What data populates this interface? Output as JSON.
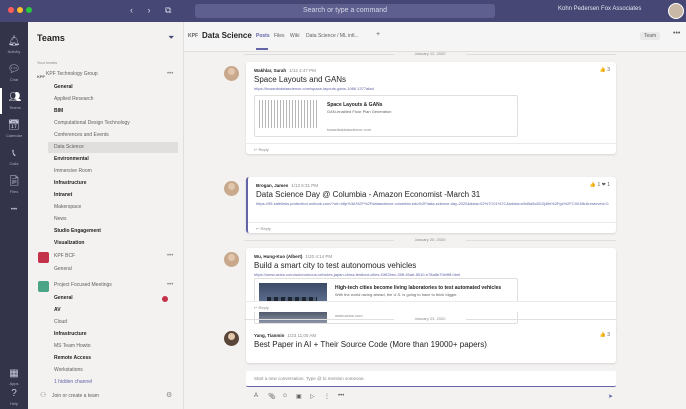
{
  "titlebar": {
    "nav_arrows": "‹ › ⧉",
    "search_placeholder": "Search or type a command",
    "org_name": "Kohn Pedersen Fox Associates",
    "colors": {
      "bg": "#464775",
      "close": "#ff5f57",
      "min": "#febc2e",
      "max": "#28c840"
    }
  },
  "rail": {
    "items": [
      {
        "icon": "bell-icon",
        "glyph": "🔔︎",
        "label": "Activity"
      },
      {
        "icon": "chat-icon",
        "glyph": "💬︎",
        "label": "Chat"
      },
      {
        "icon": "teams-icon",
        "glyph": "👥︎",
        "label": "Teams"
      },
      {
        "icon": "calendar-icon",
        "glyph": "📅︎",
        "label": "Calendar"
      },
      {
        "icon": "calls-icon",
        "glyph": "📞︎",
        "label": "Calls"
      },
      {
        "icon": "files-icon",
        "glyph": "📄︎",
        "label": "Files"
      },
      {
        "icon": "more-icon",
        "glyph": "•••",
        "label": ""
      }
    ],
    "bottom": [
      {
        "icon": "apps-icon",
        "glyph": "▦",
        "label": "Apps"
      },
      {
        "icon": "help-icon",
        "glyph": "?",
        "label": "Help"
      }
    ]
  },
  "teams_panel": {
    "title": "Teams",
    "filter_icon": "filter-icon",
    "caption": "Your teams",
    "teams": [
      {
        "abbr": "KPF",
        "name": "KPF Technology Group",
        "channels": [
          {
            "label": "General",
            "style": "bold"
          },
          {
            "label": "Applied Research",
            "style": "normal"
          },
          {
            "label": "BIM",
            "style": "bold"
          },
          {
            "label": "Computational Design Technology",
            "style": "normal"
          },
          {
            "label": "Conferences and Events",
            "style": "normal"
          },
          {
            "label": "Data Science",
            "style": "selected"
          },
          {
            "label": "Environmental",
            "style": "bold"
          },
          {
            "label": "Immersive Room",
            "style": "normal"
          },
          {
            "label": "Infrastructure",
            "style": "bold"
          },
          {
            "label": "Intranet",
            "style": "bold"
          },
          {
            "label": "Makerspace",
            "style": "normal"
          },
          {
            "label": "News",
            "style": "normal"
          },
          {
            "label": "Studio Engagement",
            "style": "bold"
          },
          {
            "label": "Visualization",
            "style": "bold"
          }
        ]
      },
      {
        "abbr": "",
        "name": "KPF BCF",
        "color": "#c4314b",
        "channels": [
          {
            "label": "General",
            "style": "normal"
          }
        ]
      },
      {
        "abbr": "",
        "name": "Project Focused Meetings",
        "color": "#4aa587",
        "channels": [
          {
            "label": "General",
            "style": "bold"
          },
          {
            "label": "AV",
            "style": "bold"
          },
          {
            "label": "Cloud",
            "style": "normal"
          },
          {
            "label": "Infrastructure",
            "style": "bold"
          },
          {
            "label": "MS Team Howto",
            "style": "normal"
          },
          {
            "label": "Remote Access",
            "style": "bold"
          },
          {
            "label": "Workstations",
            "style": "normal"
          },
          {
            "label": "1 hidden channel",
            "style": "link"
          }
        ]
      }
    ],
    "join_label": "Join or create a team"
  },
  "channel_header": {
    "team_abbr": "KPF",
    "title": "Data Science",
    "tabs": [
      "Posts",
      "Files",
      "Wiki",
      "Data Science / ML intl...",
      "+"
    ],
    "active_tab": "Posts",
    "team_pill": "Team"
  },
  "posts": [
    {
      "date": "January 12, 2020",
      "author": "Wakhlar, Sarah",
      "time": "1/12 4:47 PM",
      "subject": "Space Layouts and GANs",
      "link": "https://towardsdatascience.com/space-layouts-gans-1986 1377afad",
      "reactions": "👍 3",
      "card": {
        "title": "Space Layouts & GANs",
        "desc": "GAN-enabled Floor Plan Generation",
        "url": "towardsdatascience.com"
      },
      "reply": "↩ Reply"
    },
    {
      "date": "",
      "author": "Brogan, James",
      "time": "1/13 5:31 PM",
      "subject": "Data Science Day @ Columbia - Amazon Economist -March 31",
      "link": "https://95.safelinks.protection.outlook.com/?url=http%3A%2F%2Fdatascience.columbia.edu%2Fdata-science-day-2020&data=02%7C01%7C&sdata=e8d0a5c8G2j4ifs%2Fgx%2FC00Ji8r&reserved=0",
      "reactions": "👍 1 ❤ 1",
      "reply": "↩ Reply"
    },
    {
      "date": "January 20, 2020",
      "author": "Wu, Hung-Kuo (Albert)",
      "time": "1/20 4:14 PM",
      "subject": "Build a smart city to test autonomous vehicles",
      "link": "https://www.axios.com/autonomous-vehicles-japan-china-testbed-cities-f1f62bec-35ff-45a6-8510-e78a8b70b9f8.html",
      "reactions": "",
      "card": {
        "title": "High-tech cities become living laboratories to test automated vehicles",
        "desc": "With the world racing ahead, the U.S. is going to have to think bigger.",
        "url": "www.axios.com"
      },
      "reply": "↩ Reply"
    },
    {
      "date": "January 23, 2020",
      "author": "Yang, Tianmin",
      "time": "1/23 11:00 AM",
      "subject": "Best Paper in AI + Their Source Code (More than 19000+ papers)",
      "link": "",
      "reactions": "👍 3",
      "reply": ""
    }
  ],
  "compose": {
    "placeholder": "Start a new conversation. Type @ to mention someone.",
    "tools": [
      "A",
      "📎︎",
      "☺",
      "▣",
      "▷",
      "⋮",
      "•••"
    ],
    "send": "➤"
  }
}
